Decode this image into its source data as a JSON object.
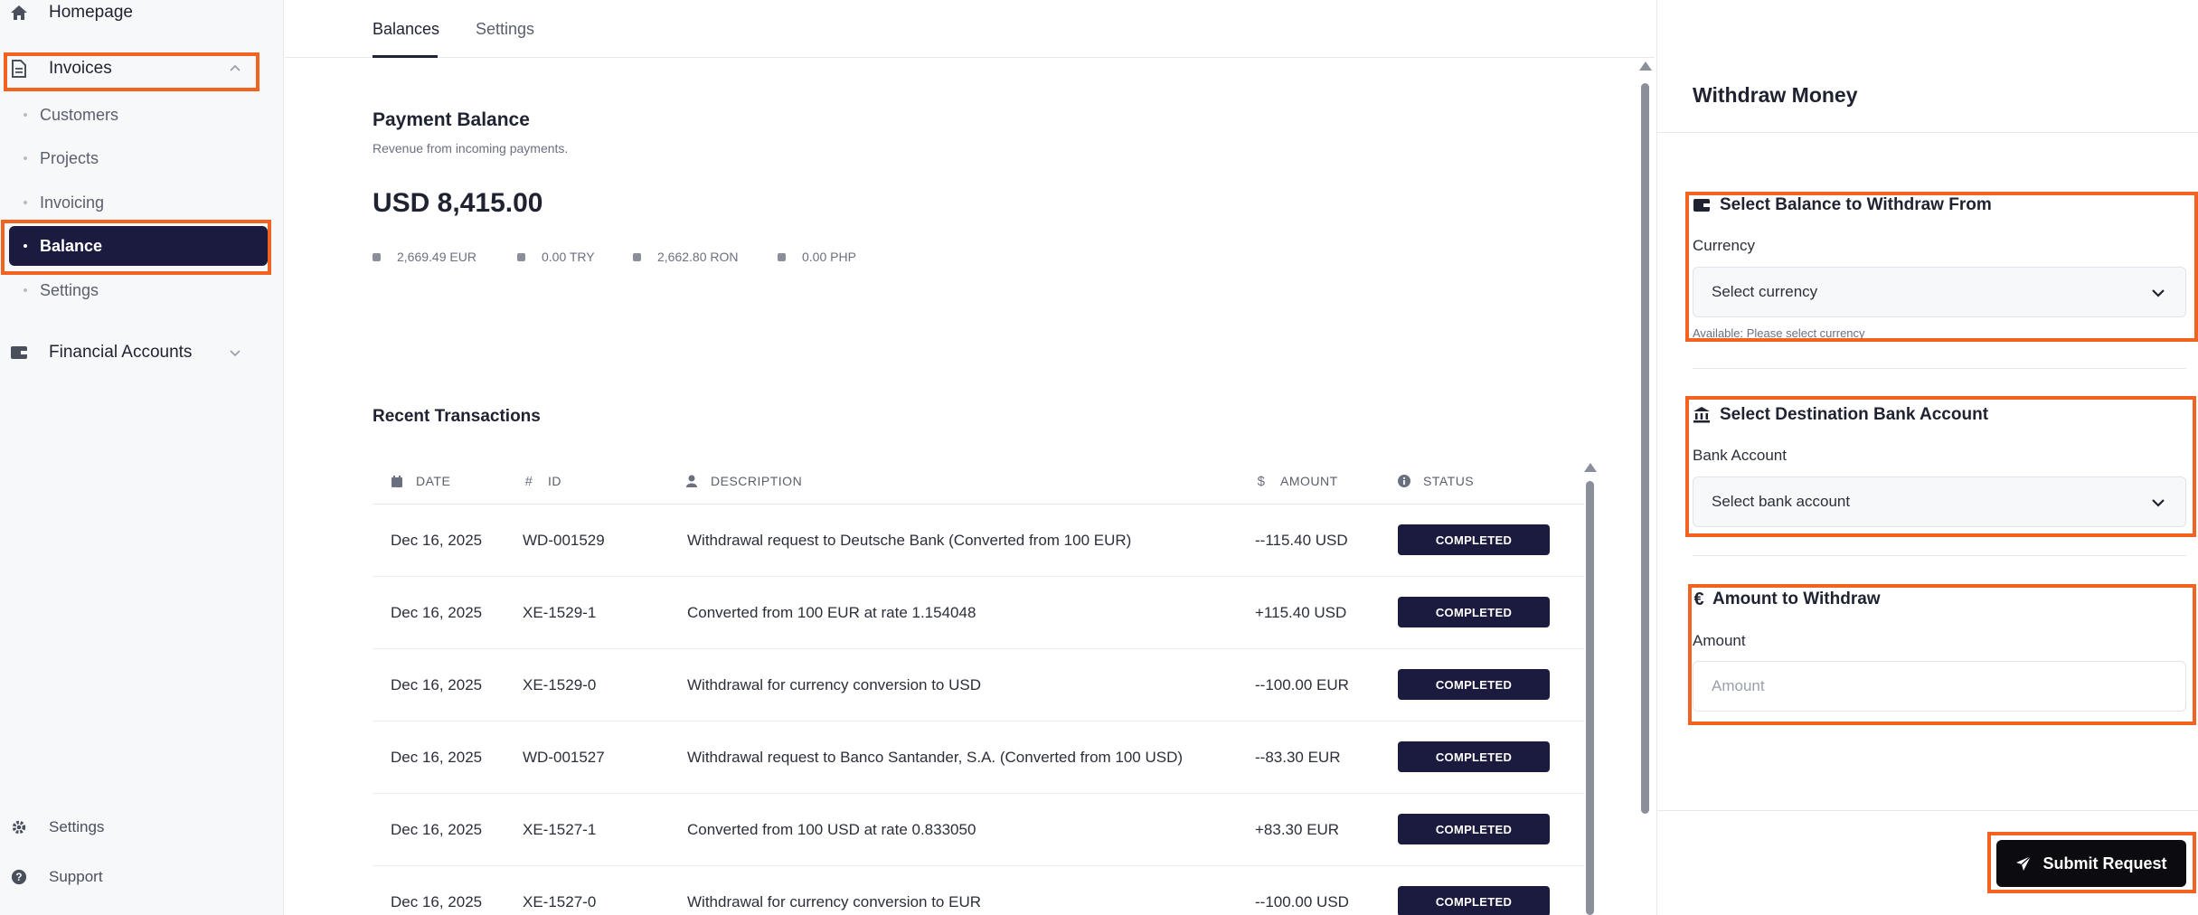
{
  "sidebar": {
    "homepage": "Homepage",
    "invoices": "Invoices",
    "sub_items": [
      "Customers",
      "Projects",
      "Invoicing",
      "Balance",
      "Settings"
    ],
    "financial_accounts": "Financial Accounts",
    "bottom_settings": "Settings",
    "support": "Support"
  },
  "tabs": {
    "balances": "Balances",
    "settings": "Settings"
  },
  "payment_balance": {
    "title": "Payment Balance",
    "subtitle": "Revenue from incoming payments.",
    "total": "USD 8,415.00",
    "currencies": [
      "2,669.49 EUR",
      "0.00 TRY",
      "2,662.80 RON",
      "0.00 PHP"
    ]
  },
  "transactions": {
    "title": "Recent Transactions",
    "headers": {
      "date": "DATE",
      "id": "ID",
      "description": "DESCRIPTION",
      "amount": "AMOUNT",
      "status": "STATUS"
    },
    "header_icons": {
      "id": "#",
      "amount": "$"
    },
    "rows": [
      {
        "date": "Dec 16, 2025",
        "id": "WD-001529",
        "description": "Withdrawal request to Deutsche Bank (Converted from 100 EUR)",
        "amount": "--115.40 USD",
        "status": "COMPLETED"
      },
      {
        "date": "Dec 16, 2025",
        "id": "XE-1529-1",
        "description": "Converted from 100 EUR at rate 1.154048",
        "amount": "+115.40 USD",
        "status": "COMPLETED"
      },
      {
        "date": "Dec 16, 2025",
        "id": "XE-1529-0",
        "description": "Withdrawal for currency conversion to USD",
        "amount": "--100.00 EUR",
        "status": "COMPLETED"
      },
      {
        "date": "Dec 16, 2025",
        "id": "WD-001527",
        "description": "Withdrawal request to Banco Santander, S.A. (Converted from 100 USD)",
        "amount": "--83.30 EUR",
        "status": "COMPLETED"
      },
      {
        "date": "Dec 16, 2025",
        "id": "XE-1527-1",
        "description": "Converted from 100 USD at rate 0.833050",
        "amount": "+83.30 EUR",
        "status": "COMPLETED"
      },
      {
        "date": "Dec 16, 2025",
        "id": "XE-1527-0",
        "description": "Withdrawal for currency conversion to EUR",
        "amount": "--100.00 USD",
        "status": "COMPLETED"
      }
    ]
  },
  "withdraw": {
    "title": "Withdraw Money",
    "balance_section": "Select Balance to Withdraw From",
    "currency_label": "Currency",
    "currency_value": "Select currency",
    "available_hint": "Available: Please select currency",
    "bank_section": "Select Destination Bank Account",
    "bank_label": "Bank Account",
    "bank_value": "Select bank account",
    "amount_section": "Amount to Withdraw",
    "amount_icon": "€",
    "amount_label": "Amount",
    "amount_placeholder": "Amount",
    "submit": "Submit Request"
  },
  "colors": {
    "accent_dark": "#1b1a3f",
    "highlight": "#f26322"
  },
  "icons": {
    "homepage": "home-icon",
    "invoices": "document-icon",
    "financial_accounts": "wallet-icon",
    "settings": "gear-icon",
    "support": "help-icon",
    "date": "calendar-icon",
    "description": "user-icon",
    "status": "info-icon",
    "balance": "wallet-icon",
    "bank": "bank-icon",
    "submit": "send-icon"
  }
}
